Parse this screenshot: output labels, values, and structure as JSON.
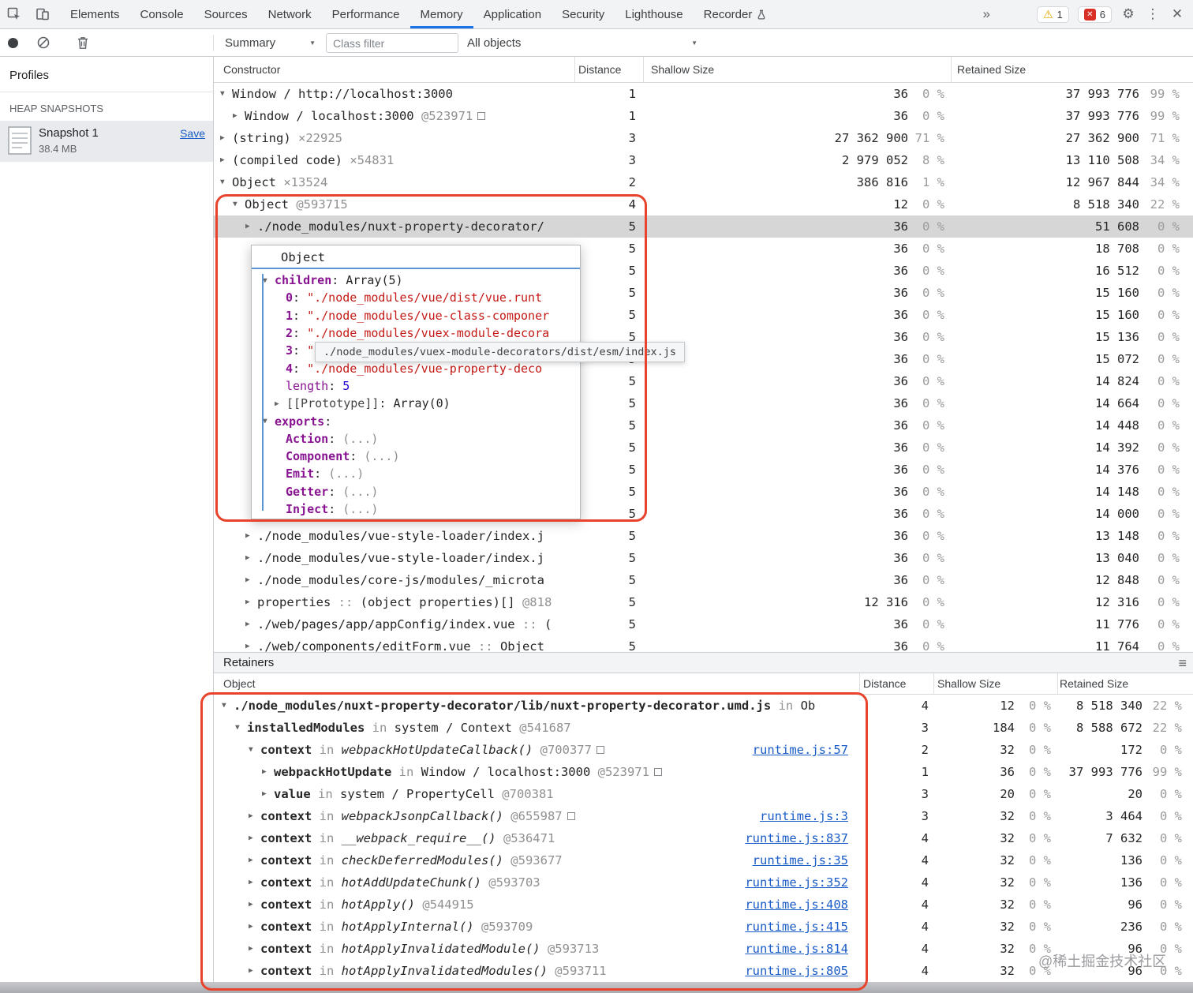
{
  "icons": {
    "more": "»",
    "warning": "⚠",
    "x": "✕",
    "gear": "⚙",
    "dots": "⋮",
    "close": "✕",
    "caret": "▼",
    "hamburger": "≡"
  },
  "tabbar": {
    "tabs": [
      {
        "label": "Elements"
      },
      {
        "label": "Console"
      },
      {
        "label": "Sources"
      },
      {
        "label": "Network"
      },
      {
        "label": "Performance"
      },
      {
        "label": "Memory"
      },
      {
        "label": "Application"
      },
      {
        "label": "Security"
      },
      {
        "label": "Lighthouse"
      },
      {
        "label": "Recorder",
        "flask": true
      }
    ],
    "active": "Memory",
    "warning_badge": "1",
    "error_badge": "6"
  },
  "toolbar": {
    "summary_dropdown": "Summary",
    "class_filter_placeholder": "Class filter",
    "objects_dropdown": "All objects"
  },
  "sidebar": {
    "title": "Profiles",
    "section_heading": "HEAP SNAPSHOTS",
    "snapshot_name": "Snapshot 1",
    "snapshot_size": "38.4 MB",
    "save_label": "Save"
  },
  "heap_table": {
    "columns": [
      "Constructor",
      "Distance",
      "Shallow Size",
      "Retained Size"
    ],
    "rows": [
      {
        "level": 0,
        "exp": "open",
        "segs": [
          [
            "plain",
            "Window / http://localhost:3000"
          ]
        ],
        "distance": "1",
        "shallow": "36",
        "shallow_pct": "0 %",
        "retained": "37 993 776",
        "retained_pct": "99 %"
      },
      {
        "level": 1,
        "exp": "closed",
        "segs": [
          [
            "plain",
            "Window / localhost:3000"
          ],
          [
            "id",
            " @523971"
          ],
          [
            "box",
            ""
          ]
        ],
        "distance": "1",
        "shallow": "36",
        "shallow_pct": "0 %",
        "retained": "37 993 776",
        "retained_pct": "99 %"
      },
      {
        "level": 0,
        "exp": "closed",
        "segs": [
          [
            "plain",
            "(string)"
          ],
          [
            "count",
            " ×22925"
          ]
        ],
        "distance": "3",
        "shallow": "27 362 900",
        "shallow_pct": "71 %",
        "retained": "27 362 900",
        "retained_pct": "71 %"
      },
      {
        "level": 0,
        "exp": "closed",
        "segs": [
          [
            "plain",
            "(compiled code)"
          ],
          [
            "count",
            " ×54831"
          ]
        ],
        "distance": "3",
        "shallow": "2 979 052",
        "shallow_pct": "8 %",
        "retained": "13 110 508",
        "retained_pct": "34 %"
      },
      {
        "level": 0,
        "exp": "open",
        "segs": [
          [
            "plain",
            "Object"
          ],
          [
            "count",
            " ×13524"
          ]
        ],
        "distance": "2",
        "shallow": "386 816",
        "shallow_pct": "1 %",
        "retained": "12 967 844",
        "retained_pct": "34 %"
      },
      {
        "level": 1,
        "exp": "open",
        "segs": [
          [
            "plain",
            "Object"
          ],
          [
            "id",
            " @593715"
          ]
        ],
        "distance": "4",
        "shallow": "12",
        "shallow_pct": "0 %",
        "retained": "8 518 340",
        "retained_pct": "22 %"
      },
      {
        "level": 2,
        "exp": "closed",
        "highlight": true,
        "segs": [
          [
            "plain",
            "./node_modules/nuxt-property-decorator/"
          ]
        ],
        "distance": "5",
        "shallow": "36",
        "shallow_pct": "0 %",
        "retained": "51 608",
        "retained_pct": "0 %"
      },
      {
        "level": 2,
        "segs": [],
        "distance": "5",
        "shallow": "36",
        "shallow_pct": "0 %",
        "retained": "18 708",
        "retained_pct": "0 %"
      },
      {
        "level": 2,
        "segs": [],
        "distance": "5",
        "shallow": "36",
        "shallow_pct": "0 %",
        "retained": "16 512",
        "retained_pct": "0 %"
      },
      {
        "level": 2,
        "segs": [],
        "distance": "5",
        "shallow": "36",
        "shallow_pct": "0 %",
        "retained": "15 160",
        "retained_pct": "0 %"
      },
      {
        "level": 2,
        "segs": [],
        "distance": "5",
        "shallow": "36",
        "shallow_pct": "0 %",
        "retained": "15 160",
        "retained_pct": "0 %"
      },
      {
        "level": 2,
        "segs": [],
        "distance": "5",
        "shallow": "36",
        "shallow_pct": "0 %",
        "retained": "15 136",
        "retained_pct": "0 %"
      },
      {
        "level": 2,
        "segs": [],
        "distance": "5",
        "shallow": "36",
        "shallow_pct": "0 %",
        "retained": "15 072",
        "retained_pct": "0 %"
      },
      {
        "level": 2,
        "segs": [],
        "distance": "5",
        "shallow": "36",
        "shallow_pct": "0 %",
        "retained": "14 824",
        "retained_pct": "0 %"
      },
      {
        "level": 2,
        "segs": [],
        "distance": "5",
        "shallow": "36",
        "shallow_pct": "0 %",
        "retained": "14 664",
        "retained_pct": "0 %"
      },
      {
        "level": 2,
        "segs": [],
        "distance": "5",
        "shallow": "36",
        "shallow_pct": "0 %",
        "retained": "14 448",
        "retained_pct": "0 %"
      },
      {
        "level": 2,
        "segs": [],
        "distance": "5",
        "shallow": "36",
        "shallow_pct": "0 %",
        "retained": "14 392",
        "retained_pct": "0 %"
      },
      {
        "level": 2,
        "segs": [],
        "distance": "5",
        "shallow": "36",
        "shallow_pct": "0 %",
        "retained": "14 376",
        "retained_pct": "0 %"
      },
      {
        "level": 2,
        "segs": [],
        "distance": "5",
        "shallow": "36",
        "shallow_pct": "0 %",
        "retained": "14 148",
        "retained_pct": "0 %"
      },
      {
        "level": 2,
        "segs": [],
        "distance": "5",
        "shallow": "36",
        "shallow_pct": "0 %",
        "retained": "14 000",
        "retained_pct": "0 %"
      },
      {
        "level": 2,
        "exp": "closed",
        "segs": [
          [
            "plain",
            "./node_modules/vue-style-loader/index.j"
          ]
        ],
        "distance": "5",
        "shallow": "36",
        "shallow_pct": "0 %",
        "retained": "13 148",
        "retained_pct": "0 %"
      },
      {
        "level": 2,
        "exp": "closed",
        "segs": [
          [
            "plain",
            "./node_modules/vue-style-loader/index.j"
          ]
        ],
        "distance": "5",
        "shallow": "36",
        "shallow_pct": "0 %",
        "retained": "13 040",
        "retained_pct": "0 %"
      },
      {
        "level": 2,
        "exp": "closed",
        "segs": [
          [
            "plain",
            "./node_modules/core-js/modules/_microta"
          ]
        ],
        "distance": "5",
        "shallow": "36",
        "shallow_pct": "0 %",
        "retained": "12 848",
        "retained_pct": "0 %"
      },
      {
        "level": 2,
        "exp": "closed",
        "segs": [
          [
            "plain",
            "properties"
          ],
          [
            "dim",
            " :: "
          ],
          [
            "plain",
            "(object properties)[]"
          ],
          [
            "id",
            " @818"
          ]
        ],
        "distance": "5",
        "shallow": "12 316",
        "shallow_pct": "0 %",
        "retained": "12 316",
        "retained_pct": "0 %"
      },
      {
        "level": 2,
        "exp": "closed",
        "segs": [
          [
            "plain",
            "./web/pages/app/appConfig/index.vue"
          ],
          [
            "dim",
            " :: "
          ],
          [
            "plain",
            "("
          ]
        ],
        "distance": "5",
        "shallow": "36",
        "shallow_pct": "0 %",
        "retained": "11 776",
        "retained_pct": "0 %"
      },
      {
        "level": 2,
        "exp": "closed",
        "segs": [
          [
            "plain",
            "./web/components/editForm.vue"
          ],
          [
            "dim",
            " :: "
          ],
          [
            "plain",
            "Object"
          ]
        ],
        "distance": "5",
        "shallow": "36",
        "shallow_pct": "0 %",
        "retained": "11 764",
        "retained_pct": "0 %"
      }
    ]
  },
  "popup": {
    "title": "Object",
    "lines": [
      {
        "level": 0,
        "exp": "open",
        "segs": [
          [
            "pkey",
            "children"
          ],
          [
            "plain",
            ": "
          ],
          [
            "plain",
            "Array(5)"
          ]
        ]
      },
      {
        "level": 1,
        "segs": [
          [
            "pkey",
            "0"
          ],
          [
            "plain",
            ": "
          ],
          [
            "str",
            "\"./node_modules/vue/dist/vue.runt"
          ]
        ]
      },
      {
        "level": 1,
        "segs": [
          [
            "pkey",
            "1"
          ],
          [
            "plain",
            ": "
          ],
          [
            "str",
            "\"./node_modules/vue-class-componer"
          ]
        ]
      },
      {
        "level": 1,
        "segs": [
          [
            "pkey",
            "2"
          ],
          [
            "plain",
            ": "
          ],
          [
            "str",
            "\"./node_modules/vuex-module-decora"
          ]
        ]
      },
      {
        "level": 1,
        "segs": [
          [
            "pkey",
            "3"
          ],
          [
            "plain",
            ": "
          ],
          [
            "str",
            "\"./node_modules/vuex-module-decora"
          ]
        ]
      },
      {
        "level": 1,
        "segs": [
          [
            "pkey",
            "4"
          ],
          [
            "plain",
            ": "
          ],
          [
            "str",
            "\"./node_modules/vue-property-deco"
          ]
        ]
      },
      {
        "level": 1,
        "segs": [
          [
            "pkeyn",
            "length"
          ],
          [
            "plain",
            ": "
          ],
          [
            "num",
            "5"
          ]
        ]
      },
      {
        "level": 1,
        "exp": "closed",
        "segs": [
          [
            "proto",
            "[[Prototype]]"
          ],
          [
            "plain",
            ": "
          ],
          [
            "plain",
            "Array(0)"
          ]
        ]
      },
      {
        "level": 0,
        "exp": "open",
        "segs": [
          [
            "pkey",
            "exports"
          ],
          [
            "plain",
            ":"
          ]
        ]
      },
      {
        "level": 1,
        "segs": [
          [
            "pkey",
            "Action"
          ],
          [
            "plain",
            ": "
          ],
          [
            "paren",
            "(...)"
          ]
        ]
      },
      {
        "level": 1,
        "segs": [
          [
            "pkey",
            "Component"
          ],
          [
            "plain",
            ": "
          ],
          [
            "paren",
            "(...)"
          ]
        ]
      },
      {
        "level": 1,
        "segs": [
          [
            "pkey",
            "Emit"
          ],
          [
            "plain",
            ": "
          ],
          [
            "paren",
            "(...)"
          ]
        ]
      },
      {
        "level": 1,
        "segs": [
          [
            "pkey",
            "Getter"
          ],
          [
            "plain",
            ": "
          ],
          [
            "paren",
            "(...)"
          ]
        ]
      },
      {
        "level": 1,
        "segs": [
          [
            "pkey",
            "Inject"
          ],
          [
            "plain",
            ": "
          ],
          [
            "paren",
            "(...)"
          ]
        ]
      }
    ]
  },
  "tooltip_text": "./node_modules/vuex-module-decorators/dist/esm/index.js",
  "retainers": {
    "title": "Retainers",
    "columns": [
      "Object",
      "Distance",
      "Shallow Size",
      "Retained Size"
    ],
    "rows": [
      {
        "level": 0,
        "exp": "open",
        "segs": [
          [
            "key",
            "./node_modules/nuxt-property-decorator/lib/nuxt-property-decorator.umd.js"
          ],
          [
            "dim",
            " in "
          ],
          [
            "plain",
            "Ob"
          ]
        ],
        "distance": "4",
        "shallow": "12",
        "shallow_pct": "0 %",
        "retained": "8 518 340",
        "retained_pct": "22 %"
      },
      {
        "level": 1,
        "exp": "open",
        "segs": [
          [
            "key",
            "installedModules"
          ],
          [
            "dim",
            " in "
          ],
          [
            "plain",
            "system / Context"
          ],
          [
            "id",
            " @541687"
          ]
        ],
        "distance": "3",
        "shallow": "184",
        "shallow_pct": "0 %",
        "retained": "8 588 672",
        "retained_pct": "22 %"
      },
      {
        "level": 2,
        "exp": "open",
        "segs": [
          [
            "key",
            "context"
          ],
          [
            "dim",
            " in "
          ],
          [
            "fn",
            "webpackHotUpdateCallback()"
          ],
          [
            "id",
            " @700377"
          ],
          [
            "box",
            ""
          ]
        ],
        "link": "runtime.js:57",
        "distance": "2",
        "shallow": "32",
        "shallow_pct": "0 %",
        "retained": "172",
        "retained_pct": "0 %"
      },
      {
        "level": 3,
        "exp": "closed",
        "segs": [
          [
            "key",
            "webpackHotUpdate"
          ],
          [
            "dim",
            " in "
          ],
          [
            "plain",
            "Window / localhost:3000"
          ],
          [
            "id",
            " @523971"
          ],
          [
            "box",
            ""
          ]
        ],
        "distance": "1",
        "shallow": "36",
        "shallow_pct": "0 %",
        "retained": "37 993 776",
        "retained_pct": "99 %"
      },
      {
        "level": 3,
        "exp": "closed",
        "segs": [
          [
            "key",
            "value"
          ],
          [
            "dim",
            " in "
          ],
          [
            "plain",
            "system / PropertyCell"
          ],
          [
            "id",
            " @700381"
          ]
        ],
        "distance": "3",
        "shallow": "20",
        "shallow_pct": "0 %",
        "retained": "20",
        "retained_pct": "0 %"
      },
      {
        "level": 2,
        "exp": "closed",
        "segs": [
          [
            "key",
            "context"
          ],
          [
            "dim",
            " in "
          ],
          [
            "fn",
            "webpackJsonpCallback()"
          ],
          [
            "id",
            " @655987"
          ],
          [
            "box",
            ""
          ]
        ],
        "link": "runtime.js:3",
        "distance": "3",
        "shallow": "32",
        "shallow_pct": "0 %",
        "retained": "3 464",
        "retained_pct": "0 %"
      },
      {
        "level": 2,
        "exp": "closed",
        "segs": [
          [
            "key",
            "context"
          ],
          [
            "dim",
            " in "
          ],
          [
            "fn",
            "__webpack_require__()"
          ],
          [
            "id",
            " @536471"
          ]
        ],
        "link": "runtime.js:837",
        "distance": "4",
        "shallow": "32",
        "shallow_pct": "0 %",
        "retained": "7 632",
        "retained_pct": "0 %"
      },
      {
        "level": 2,
        "exp": "closed",
        "segs": [
          [
            "key",
            "context"
          ],
          [
            "dim",
            " in "
          ],
          [
            "fn",
            "checkDeferredModules()"
          ],
          [
            "id",
            " @593677"
          ]
        ],
        "link": "runtime.js:35",
        "distance": "4",
        "shallow": "32",
        "shallow_pct": "0 %",
        "retained": "136",
        "retained_pct": "0 %"
      },
      {
        "level": 2,
        "exp": "closed",
        "segs": [
          [
            "key",
            "context"
          ],
          [
            "dim",
            " in "
          ],
          [
            "fn",
            "hotAddUpdateChunk()"
          ],
          [
            "id",
            " @593703"
          ]
        ],
        "link": "runtime.js:352",
        "distance": "4",
        "shallow": "32",
        "shallow_pct": "0 %",
        "retained": "136",
        "retained_pct": "0 %"
      },
      {
        "level": 2,
        "exp": "closed",
        "segs": [
          [
            "key",
            "context"
          ],
          [
            "dim",
            " in "
          ],
          [
            "fn",
            "hotApply()"
          ],
          [
            "id",
            " @544915"
          ]
        ],
        "link": "runtime.js:408",
        "distance": "4",
        "shallow": "32",
        "shallow_pct": "0 %",
        "retained": "96",
        "retained_pct": "0 %"
      },
      {
        "level": 2,
        "exp": "closed",
        "segs": [
          [
            "key",
            "context"
          ],
          [
            "dim",
            " in "
          ],
          [
            "fn",
            "hotApplyInternal()"
          ],
          [
            "id",
            " @593709"
          ]
        ],
        "link": "runtime.js:415",
        "distance": "4",
        "shallow": "32",
        "shallow_pct": "0 %",
        "retained": "236",
        "retained_pct": "0 %"
      },
      {
        "level": 2,
        "exp": "closed",
        "segs": [
          [
            "key",
            "context"
          ],
          [
            "dim",
            " in "
          ],
          [
            "fn",
            "hotApplyInvalidatedModule()"
          ],
          [
            "id",
            " @593713"
          ]
        ],
        "link": "runtime.js:814",
        "distance": "4",
        "shallow": "32",
        "shallow_pct": "0 %",
        "retained": "96",
        "retained_pct": "0 %"
      },
      {
        "level": 2,
        "exp": "closed",
        "segs": [
          [
            "key",
            "context"
          ],
          [
            "dim",
            " in "
          ],
          [
            "fn",
            "hotApplyInvalidatedModules()"
          ],
          [
            "id",
            " @593711"
          ]
        ],
        "link": "runtime.js:805",
        "distance": "4",
        "shallow": "32",
        "shallow_pct": "0 %",
        "retained": "96",
        "retained_pct": "0 %"
      }
    ]
  },
  "watermark": "@稀土掘金技术社区"
}
